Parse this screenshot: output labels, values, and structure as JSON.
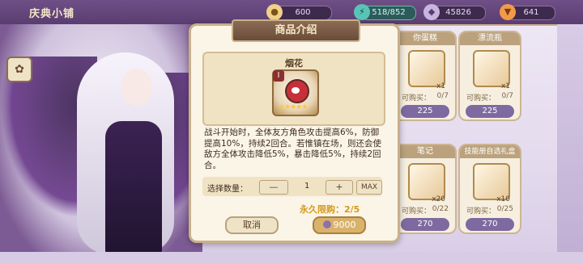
{
  "topbar": {
    "title": "庆典小铺",
    "resources": [
      {
        "name": "currency-1",
        "value": "600",
        "icon": "coin-icon"
      },
      {
        "name": "currency-2",
        "value": "518/852",
        "icon": "energy-icon"
      },
      {
        "name": "currency-3",
        "value": "45826",
        "icon": "gem-icon"
      },
      {
        "name": "currency-4",
        "value": "641",
        "icon": "carrot-icon"
      }
    ]
  },
  "dialog": {
    "title": "商品介绍",
    "item_name": "烟花",
    "item_level": "I",
    "description": "战斗开始时，全体友方角色攻击提高6%，防御提高10%，持续2回合。若惟镇在场，则还会使敌方全体攻击降低5%，暴击降低5%，持续2回合。",
    "qty_label": "选择数量：",
    "qty_minus": "—",
    "qty_value": "1",
    "qty_plus": "+",
    "qty_max": "MAX",
    "limit_text": "永久限购：2/5",
    "cancel_label": "取消",
    "buy_price": "9000"
  },
  "shop_items": [
    {
      "title": "你蛋糕",
      "count": "x1",
      "purchase_label": "可购买：",
      "purchase_value": "0/7",
      "price": "225"
    },
    {
      "title": "漂流瓶",
      "count": "x1",
      "purchase_label": "可购买：",
      "purchase_value": "0/7",
      "price": "225"
    },
    {
      "title": "笔记",
      "count": "x20",
      "purchase_label": "可购买：",
      "purchase_value": "0/22",
      "price": "270"
    },
    {
      "title": "技能册自选礼盒",
      "count": "x10",
      "purchase_label": "可购买：",
      "purchase_value": "0/25",
      "price": "270"
    }
  ]
}
